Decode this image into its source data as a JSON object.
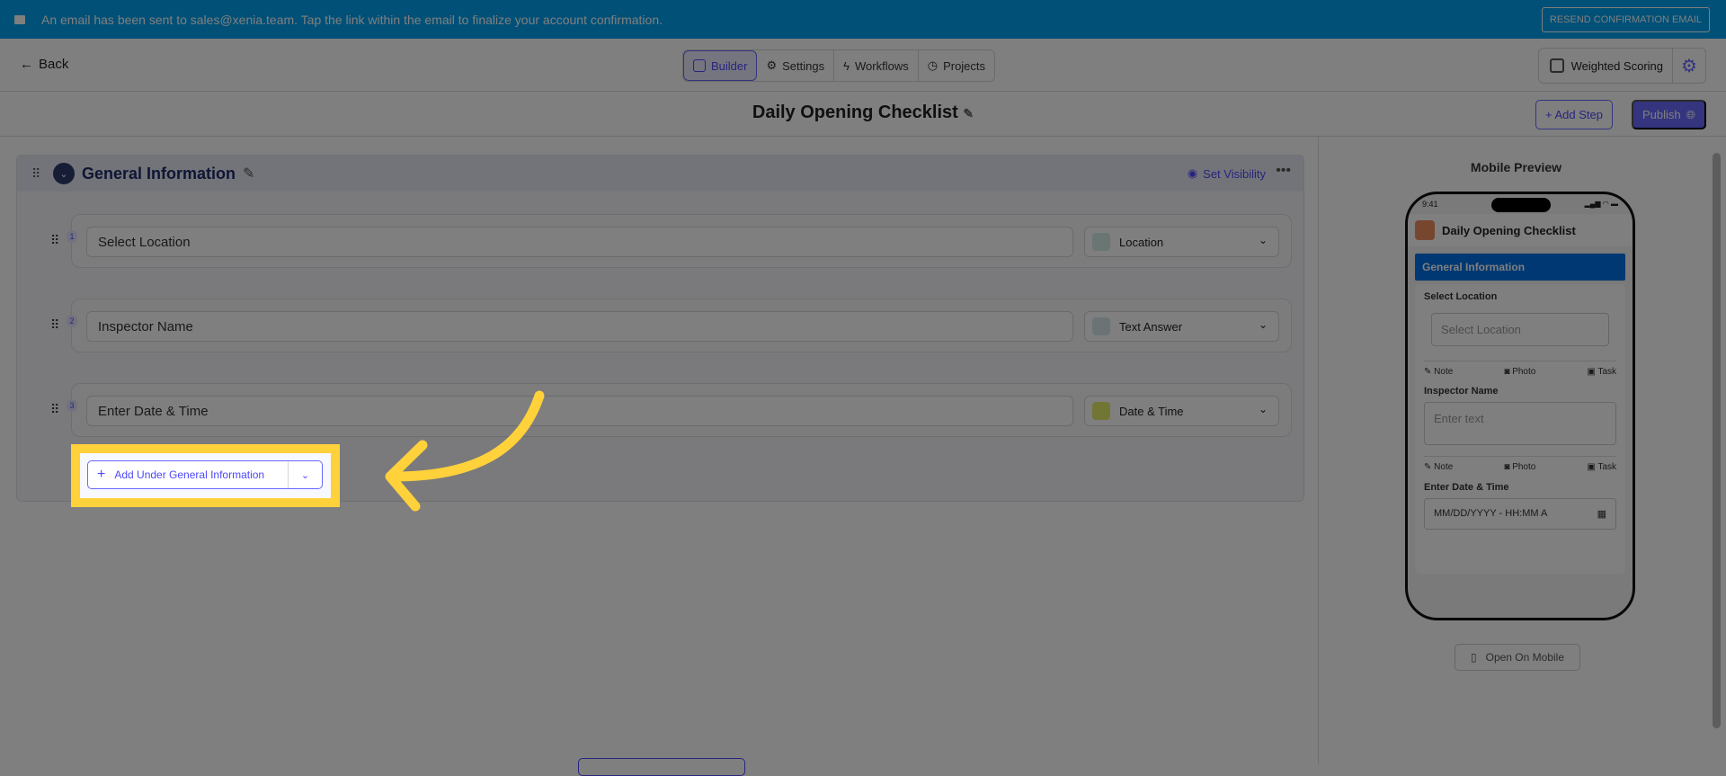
{
  "banner": {
    "message": "An email has been sent to sales@xenia.team. Tap the link within the email to finalize your account confirmation.",
    "resend_label": "RESEND CONFIRMATION EMAIL"
  },
  "nav": {
    "back_label": "Back",
    "tabs": [
      {
        "label": "Builder"
      },
      {
        "label": "Settings"
      },
      {
        "label": "Workflows"
      },
      {
        "label": "Projects"
      }
    ],
    "weighted_scoring_label": "Weighted Scoring"
  },
  "header": {
    "title": "Daily Opening Checklist",
    "add_step_label": "+ Add Step",
    "publish_label": "Publish"
  },
  "section": {
    "title": "General Information",
    "set_visibility_label": "Set Visibility",
    "add_under_label": "Add Under General Information",
    "questions": [
      {
        "num": "1",
        "text": "Select Location",
        "type": "Location"
      },
      {
        "num": "2",
        "text": "Inspector Name",
        "type": "Text Answer"
      },
      {
        "num": "3",
        "text": "Enter Date & Time",
        "type": "Date & Time"
      }
    ]
  },
  "preview": {
    "title": "Mobile Preview",
    "time": "9:41",
    "checklist_title": "Daily Opening Checklist",
    "section": "General Information",
    "q1_label": "Select Location",
    "q1_placeholder": "Select Location",
    "q2_label": "Inspector Name",
    "q2_placeholder": "Enter text",
    "q3_label": "Enter Date & Time",
    "q3_placeholder": "MM/DD/YYYY - HH:MM A",
    "note": "Note",
    "photo": "Photo",
    "task": "Task",
    "open_mobile_label": "Open On Mobile"
  },
  "colors": {
    "accent": "#6868fe",
    "banner": "#00a0ee",
    "highlight": "#ffd13b"
  }
}
